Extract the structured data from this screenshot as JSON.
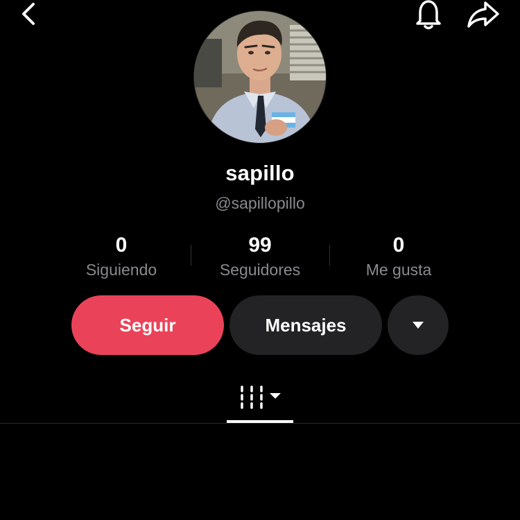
{
  "profile": {
    "display_name": "sapillo",
    "handle": "@sapillopillo"
  },
  "stats": {
    "following": {
      "value": "0",
      "label": "Siguiendo"
    },
    "followers": {
      "value": "99",
      "label": "Seguidores"
    },
    "likes": {
      "value": "0",
      "label": "Me gusta"
    }
  },
  "actions": {
    "follow_label": "Seguir",
    "message_label": "Mensajes"
  },
  "icons": {
    "back": "chevron-left-icon",
    "notifications": "bell-icon",
    "share": "share-arrow-icon",
    "more": "caret-down-icon",
    "videos_tab": "grid-icon"
  },
  "colors": {
    "background": "#000000",
    "follow_button": "#ea4359",
    "secondary_button": "#232326",
    "muted_text": "#8a8a8f"
  }
}
